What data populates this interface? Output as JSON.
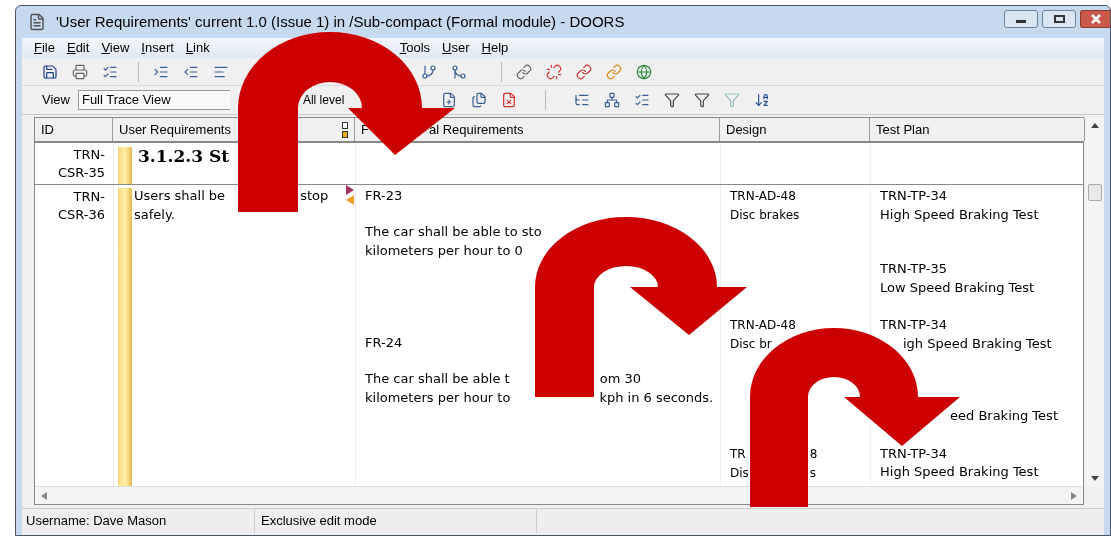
{
  "window": {
    "title": "'User Requirements' current 1.0 (Issue 1) in /Sub-compact (Formal module) - DOORS"
  },
  "menu": [
    "File",
    "Edit",
    "View",
    "Insert",
    "Link",
    "Tools",
    "User",
    "Help"
  ],
  "view_bar": {
    "label": "View",
    "view": "Full Trace View",
    "levels": "All level"
  },
  "table": {
    "columns": [
      [
        "ID"
      ],
      [
        "User Requirements"
      ],
      [
        "F",
        "al Requirements"
      ],
      [
        "Design"
      ],
      [
        "Test Plan"
      ]
    ],
    "rows": [
      {
        "id": "TRN-CSR-35",
        "heading": "3.1.2.3 St"
      },
      {
        "id": "TRN-CSR-36",
        "requirement": [
          [
            "Users shall be",
            "stop"
          ],
          [
            "safely."
          ]
        ],
        "link_out": true,
        "link_in": true,
        "functional": [
          {
            "id": "FR-23",
            "text": [
              [
                "The car shall be able to sto"
              ],
              [
                "kilometers per hour to 0"
              ]
            ]
          },
          {
            "id": "FR-24",
            "text": [
              [
                "The car shall be able t",
                "om 30"
              ],
              [
                "kilometers per hour to",
                "kph in 6 seconds."
              ]
            ]
          }
        ],
        "design": [
          {
            "id": [
              "TRN-AD-48"
            ],
            "name": [
              "Disc brakes"
            ]
          },
          {
            "id": [
              "TRN-AD-48"
            ],
            "name": [
              "Disc br"
            ]
          },
          {
            "id": [
              "TR",
              "8"
            ],
            "name": [
              "Dis",
              "s"
            ]
          }
        ],
        "test_plan": [
          {
            "id": [
              "TRN-TP-34"
            ],
            "name": [
              "High Speed Braking Test"
            ]
          },
          {
            "id": [
              "TRN-TP-35"
            ],
            "name": [
              "Low Speed Braking Test"
            ]
          },
          {
            "id": [
              "TRN-TP-34"
            ],
            "name": [
              "igh Speed Braking Test"
            ]
          },
          {
            "name": [
              "eed Braking Test"
            ]
          },
          {
            "id": [
              "TRN-TP-34"
            ],
            "name": [
              "High Speed Braking Test"
            ]
          }
        ]
      }
    ]
  },
  "status_bar": [
    "Username: Dave Mason",
    "Exclusive edit mode"
  ]
}
